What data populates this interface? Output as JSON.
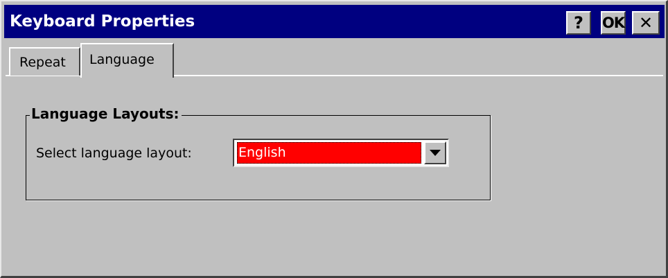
{
  "window": {
    "title": "Keyboard Properties",
    "help_label": "?",
    "ok_label": "OK",
    "close_label": "✕"
  },
  "tabs": [
    {
      "label": "Repeat",
      "active": false
    },
    {
      "label": "Language",
      "active": true
    }
  ],
  "language_group": {
    "title": "Language Layouts:",
    "select_label": "Select language layout:",
    "selected_value": "English"
  },
  "colors": {
    "title_bar": "#000080",
    "face": "#c0c0c0",
    "selection_highlight": "#ff0000"
  },
  "icons": [
    "help-icon",
    "close-icon",
    "dropdown-arrow-icon"
  ]
}
